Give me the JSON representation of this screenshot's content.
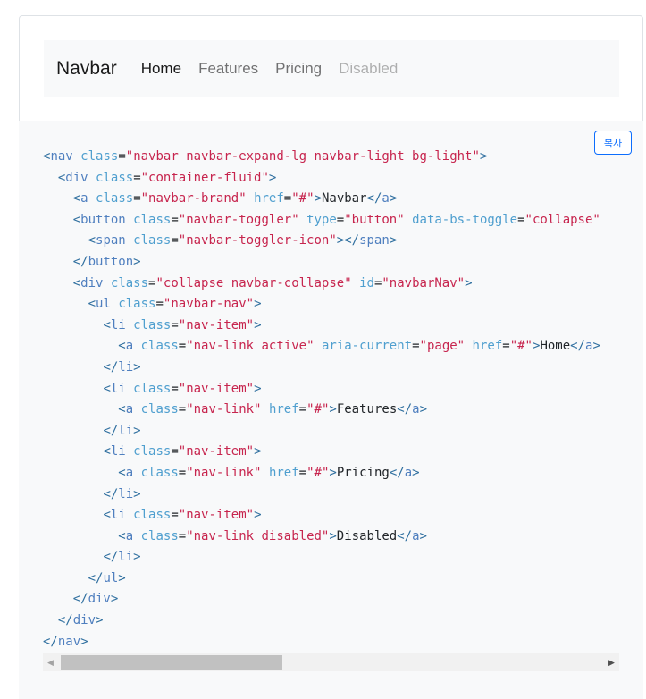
{
  "example": {
    "brand": "Navbar",
    "links": [
      {
        "label": "Home",
        "state": "active"
      },
      {
        "label": "Features",
        "state": "normal"
      },
      {
        "label": "Pricing",
        "state": "normal"
      },
      {
        "label": "Disabled",
        "state": "disabled"
      }
    ]
  },
  "code_block": {
    "copy_label": "복사",
    "lines": [
      "<nav class=\"navbar navbar-expand-lg navbar-light bg-light\">",
      "  <div class=\"container-fluid\">",
      "    <a class=\"navbar-brand\" href=\"#\">Navbar</a>",
      "    <button class=\"navbar-toggler\" type=\"button\" data-bs-toggle=\"collapse\"",
      "      <span class=\"navbar-toggler-icon\"></span>",
      "    </button>",
      "    <div class=\"collapse navbar-collapse\" id=\"navbarNav\">",
      "      <ul class=\"navbar-nav\">",
      "        <li class=\"nav-item\">",
      "          <a class=\"nav-link active\" aria-current=\"page\" href=\"#\">Home</a>",
      "        </li>",
      "        <li class=\"nav-item\">",
      "          <a class=\"nav-link\" href=\"#\">Features</a>",
      "        </li>",
      "        <li class=\"nav-item\">",
      "          <a class=\"nav-link\" href=\"#\">Pricing</a>",
      "        </li>",
      "        <li class=\"nav-item\">",
      "          <a class=\"nav-link disabled\">Disabled</a>",
      "        </li>",
      "      </ul>",
      "    </div>",
      "  </div>",
      "</nav>"
    ]
  },
  "scrollbar": {
    "left_arrow_icon": "arrow-left-icon",
    "right_arrow_icon": "arrow-right-icon",
    "thumb_fraction": 0.38,
    "thumb_position": 0.0
  },
  "colors": {
    "tag": "#2f6f9f",
    "attribute": "#4f9fcf",
    "value": "#c7254e",
    "copy_button": "#0d6efd",
    "navbar_bg": "#f8f9fa"
  }
}
